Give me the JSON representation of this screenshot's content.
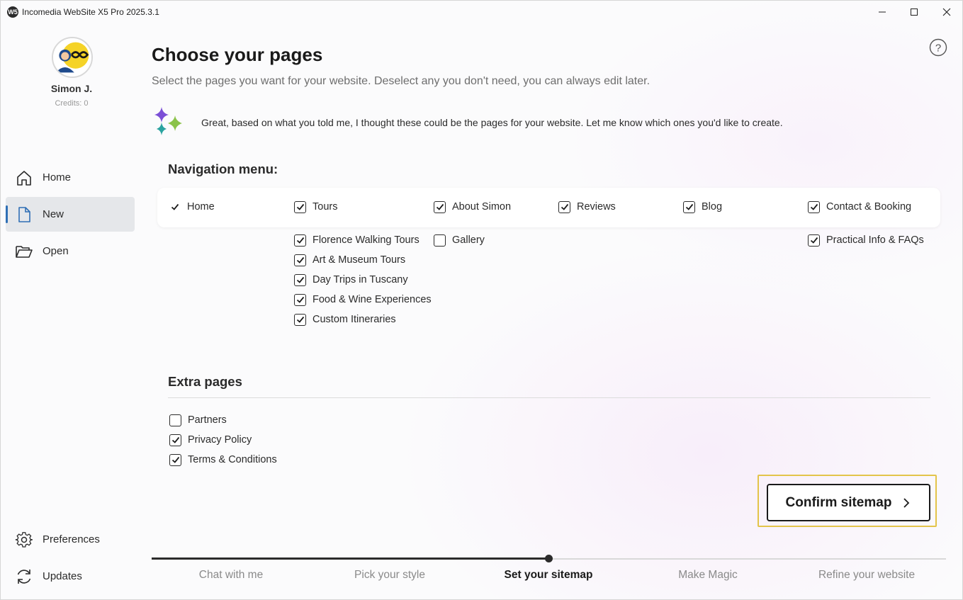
{
  "window": {
    "title": "Incomedia WebSite X5 Pro 2025.3.1",
    "app_icon": "W5",
    "controls": [
      "minimize-icon",
      "maximize-icon",
      "close-icon"
    ]
  },
  "user": {
    "name": "Simon J.",
    "credits": "Credits: 0"
  },
  "sidebar": {
    "items": [
      {
        "label": "Home",
        "icon": "home-icon",
        "active": false
      },
      {
        "label": "New",
        "icon": "new-document-icon",
        "active": true
      },
      {
        "label": "Open",
        "icon": "folder-open-icon",
        "active": false
      }
    ],
    "bottom_items": [
      {
        "label": "Preferences",
        "icon": "gear-icon"
      },
      {
        "label": "Updates",
        "icon": "refresh-icon"
      }
    ]
  },
  "main": {
    "title": "Choose your pages",
    "subtitle": "Select the pages you want for your website. Deselect any you don't need, you can always edit later.",
    "ai_message": "Great, based on what you told me, I thought these could be the pages for your website. Let me know which ones you'd like to create.",
    "nav_heading": "Navigation menu:",
    "nav_top": [
      {
        "label": "Home",
        "checked": true
      },
      {
        "label": "Tours",
        "checked": true
      },
      {
        "label": "About Simon",
        "checked": true
      },
      {
        "label": "Reviews",
        "checked": true
      },
      {
        "label": "Blog",
        "checked": true
      },
      {
        "label": "Contact & Booking",
        "checked": true
      }
    ],
    "nav_sub": {
      "tours": [
        {
          "label": "Florence Walking Tours",
          "checked": true
        },
        {
          "label": "Art & Museum Tours",
          "checked": true
        },
        {
          "label": "Day Trips in Tuscany",
          "checked": true
        },
        {
          "label": "Food & Wine Experiences",
          "checked": true
        },
        {
          "label": "Custom Itineraries",
          "checked": true
        }
      ],
      "about": [
        {
          "label": "Gallery",
          "checked": false
        }
      ],
      "contact": [
        {
          "label": "Practical Info & FAQs",
          "checked": true
        }
      ]
    },
    "extra_heading": "Extra pages",
    "extra_pages": [
      {
        "label": "Partners",
        "checked": false
      },
      {
        "label": "Privacy Policy",
        "checked": true
      },
      {
        "label": "Terms & Conditions",
        "checked": true
      }
    ],
    "confirm_label": "Confirm sitemap"
  },
  "progress": {
    "steps": [
      "Chat with me",
      "Pick your style",
      "Set your sitemap",
      "Make Magic",
      "Refine your website"
    ],
    "current_index": 2
  },
  "colors": {
    "accent": "#2f6fb5",
    "highlight": "#e3c44a",
    "sparkle_purple": "#7b4fd6",
    "sparkle_teal": "#2aa3a0",
    "sparkle_green": "#8bc34a",
    "avatar_yellow": "#f5d327",
    "avatar_blue": "#1e4a8c"
  }
}
